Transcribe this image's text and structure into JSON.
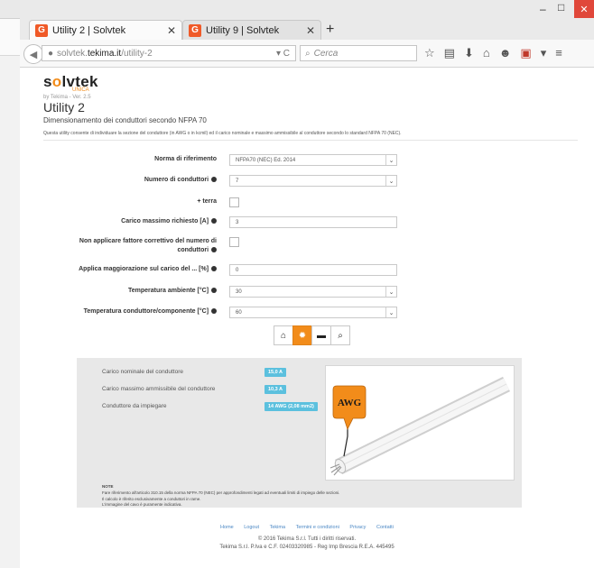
{
  "browser": {
    "tabs": [
      {
        "favicon": "G",
        "title": "Utility 2 | Solvtek",
        "active": true
      },
      {
        "favicon": "G",
        "title": "Utility 9 | Solvtek",
        "active": false
      }
    ],
    "url_prefix": "solvtek.",
    "url_host": "tekima.it",
    "url_path": "/utility-2",
    "search_placeholder": "Cerca",
    "new_tab_symbol": "+"
  },
  "site": {
    "logo_s": "s",
    "logo_o": "o",
    "logo_rest": "lvtek",
    "logo_sub": "UNICA",
    "version": "by Tekima - Ver. 2.5"
  },
  "page": {
    "title": "Utility 2",
    "subtitle": "Dimensionamento dei conduttori secondo NFPA 70",
    "description": "Questa utility consente di individuare la sezione del conduttore (in AWG o in kcmil) ed il carico nominale e massimo ammissibile al conduttore secondo lo standard NFPA 70 (NEC)."
  },
  "form": {
    "norma_label": "Norma di riferimento",
    "norma_value": "NFPA70 (NEC) Ed. 2014",
    "numero_label": "Numero di conduttori",
    "numero_value": "7",
    "terra_label": "+ terra",
    "carico_label": "Carico massimo richiesto [A]",
    "carico_value": "3",
    "non_applicare_label_1": "Non applicare fattore correttivo del numero di",
    "non_applicare_label_2": "conduttori",
    "maggiorazione_label": "Applica maggiorazione sul carico del ... [%]",
    "maggiorazione_value": "0",
    "temp_amb_label": "Temperatura ambiente [°C]",
    "temp_amb_value": "30",
    "temp_cond_label": "Temperatura conduttore/componente [°C]",
    "temp_cond_value": "60"
  },
  "results": {
    "items": [
      {
        "label": "Carico nominale del conduttore",
        "value": "15,0 A"
      },
      {
        "label": "Carico massimo ammissibile del conduttore",
        "value": "10,3 A"
      },
      {
        "label": "Conduttore da impiegare",
        "value": "14 AWG (2,08 mm2)"
      }
    ],
    "image_label": "AWG",
    "note_title": "NOTE",
    "note_lines": [
      "Fare riferimento all'articolo 310.15 della norma NFPA 70 (NEC) per approfondimenti legati ad eventuali limiti di impiego delle sezioni.",
      "Il calcolo è riferito esclusivamente a conduttori in rame.",
      "L'immagine del cavo è puramente indicativa."
    ]
  },
  "footer": {
    "links": [
      "Home",
      "Logout",
      "Tekima",
      "Termini e condizioni",
      "Privacy",
      "Contatti"
    ],
    "copyright": "© 2016 Tekima S.r.l. Tutti i diritti riservati.",
    "company": "Tekima S.r.l. P.Iva e C.F. 02403320985 - Reg Imp Brescia R.E.A. 445495"
  },
  "colors": {
    "accent": "#f28c1a",
    "badge": "#5bc0de",
    "link": "#4a87c4"
  }
}
